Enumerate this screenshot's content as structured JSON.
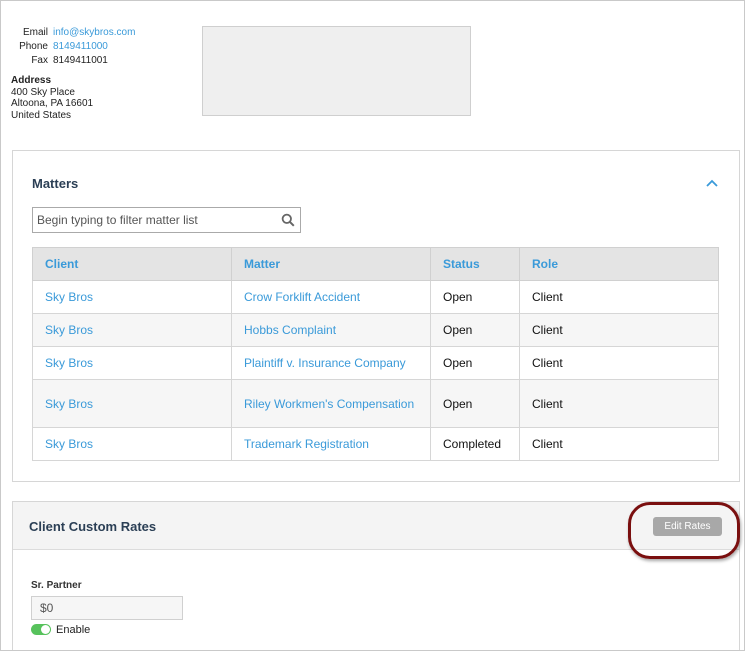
{
  "contact": {
    "email_label": "Email",
    "email_value": "info@skybros.com",
    "phone_label": "Phone",
    "phone_value": "8149411000",
    "fax_label": "Fax",
    "fax_value": "8149411001"
  },
  "address": {
    "title": "Address",
    "line1": "400 Sky Place",
    "line2": "Altoona, PA 16601",
    "line3": "United States"
  },
  "matters": {
    "title": "Matters",
    "filter_placeholder": "Begin typing to filter matter list",
    "columns": [
      "Client",
      "Matter",
      "Status",
      "Role"
    ],
    "rows": [
      {
        "client": "Sky Bros",
        "matter": "Crow Forklift Accident",
        "status": "Open",
        "role": "Client"
      },
      {
        "client": "Sky Bros",
        "matter": "Hobbs Complaint",
        "status": "Open",
        "role": "Client"
      },
      {
        "client": "Sky Bros",
        "matter": "Plaintiff v. Insurance Company",
        "status": "Open",
        "role": "Client"
      },
      {
        "client": "Sky Bros",
        "matter": "Riley Workmen's Compensation",
        "status": "Open",
        "role": "Client"
      },
      {
        "client": "Sky Bros",
        "matter": "Trademark Registration",
        "status": "Completed",
        "role": "Client"
      }
    ]
  },
  "rates": {
    "title": "Client Custom Rates",
    "edit_button": "Edit Rates",
    "sr_partner_label": "Sr. Partner",
    "sr_partner_value": "$0",
    "enable_label": "Enable",
    "enabled": true
  },
  "colors": {
    "link": "#3a9ad9",
    "heading": "#2b3f55",
    "highlight": "#7a0f0f",
    "toggle_on": "#57c25c"
  },
  "icons": {
    "collapse": "chevron-up-icon",
    "search": "search-icon"
  }
}
